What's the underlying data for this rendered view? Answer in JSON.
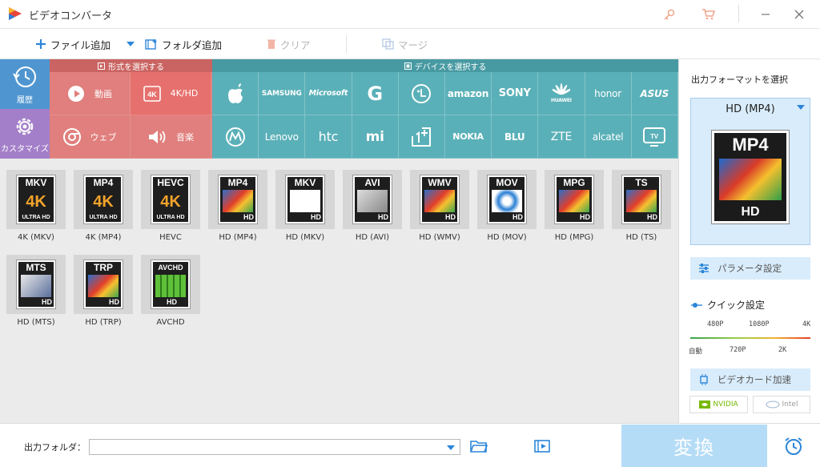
{
  "app": {
    "title": "ビデオコンバータ"
  },
  "toolbar": {
    "add_file": "ファイル追加",
    "add_folder": "フォルダ追加",
    "clear": "クリア",
    "merge": "マージ"
  },
  "categories": {
    "history": "履歴",
    "custom": "カスタマイズ"
  },
  "format_section": {
    "header": "形式を選択する",
    "items": [
      {
        "label": "動画",
        "icon": "play-icon"
      },
      {
        "label": "4K/HD",
        "icon": "4k-icon"
      },
      {
        "label": "ウェブ",
        "icon": "chrome-icon"
      },
      {
        "label": "音楽",
        "icon": "speaker-icon"
      }
    ]
  },
  "device_section": {
    "header": "デバイスを選択する",
    "brands": [
      "",
      "SAMSUNG",
      "Microsoft",
      "G",
      "LG",
      "amazon",
      "SONY",
      "HUAWEI",
      "honor",
      "ASUS",
      "",
      "Lenovo",
      "htc",
      "mi",
      "1+",
      "NOKIA",
      "BLU",
      "ZTE",
      "alcatel",
      "TV"
    ]
  },
  "formats": [
    {
      "icon": "MKV",
      "sub": "4K",
      "label": "4K (MKV)"
    },
    {
      "icon": "MP4",
      "sub": "4K",
      "label": "4K (MP4)"
    },
    {
      "icon": "HEVC",
      "sub": "4K",
      "label": "HEVC"
    },
    {
      "icon": "MP4",
      "sub": "HD",
      "label": "HD (MP4)"
    },
    {
      "icon": "MKV",
      "sub": "HD",
      "label": "HD (MKV)"
    },
    {
      "icon": "AVI",
      "sub": "HD",
      "label": "HD (AVI)"
    },
    {
      "icon": "WMV",
      "sub": "HD",
      "label": "HD (WMV)"
    },
    {
      "icon": "MOV",
      "sub": "HD",
      "label": "HD (MOV)"
    },
    {
      "icon": "MPG",
      "sub": "HD",
      "label": "HD (MPG)"
    },
    {
      "icon": "TS",
      "sub": "HD",
      "label": "HD (TS)"
    },
    {
      "icon": "MTS",
      "sub": "HD",
      "label": "HD (MTS)"
    },
    {
      "icon": "TRP",
      "sub": "HD",
      "label": "HD (TRP)"
    },
    {
      "icon": "AVCHD",
      "sub": "HD",
      "label": "AVCHD"
    }
  ],
  "ultra_hd_text": "ULTRA HD",
  "right_panel": {
    "title": "出力フォーマットを選択",
    "selected": "HD (MP4)",
    "preview_type": "MP4",
    "preview_sub": "HD",
    "param_settings": "パラメータ設定",
    "quick_settings": "クイック設定",
    "slider_top": [
      "480P",
      "1080P",
      "4K"
    ],
    "slider_bottom": [
      "自動",
      "720P",
      "2K"
    ],
    "gpu_accel": "ビデオカード加速",
    "nvidia": "NVIDIA",
    "intel": "Intel"
  },
  "bottom": {
    "output_folder_label": "出力フォルダ：",
    "output_folder_value": "",
    "convert": "変換"
  },
  "colors": {
    "format_red": "#e07f7d",
    "device_teal": "#5ab0b8",
    "history_blue": "#4f96d1",
    "custom_purple": "#a47fc9",
    "accent_blue": "#2c86d8",
    "convert_bg": "#b4dcf7"
  }
}
